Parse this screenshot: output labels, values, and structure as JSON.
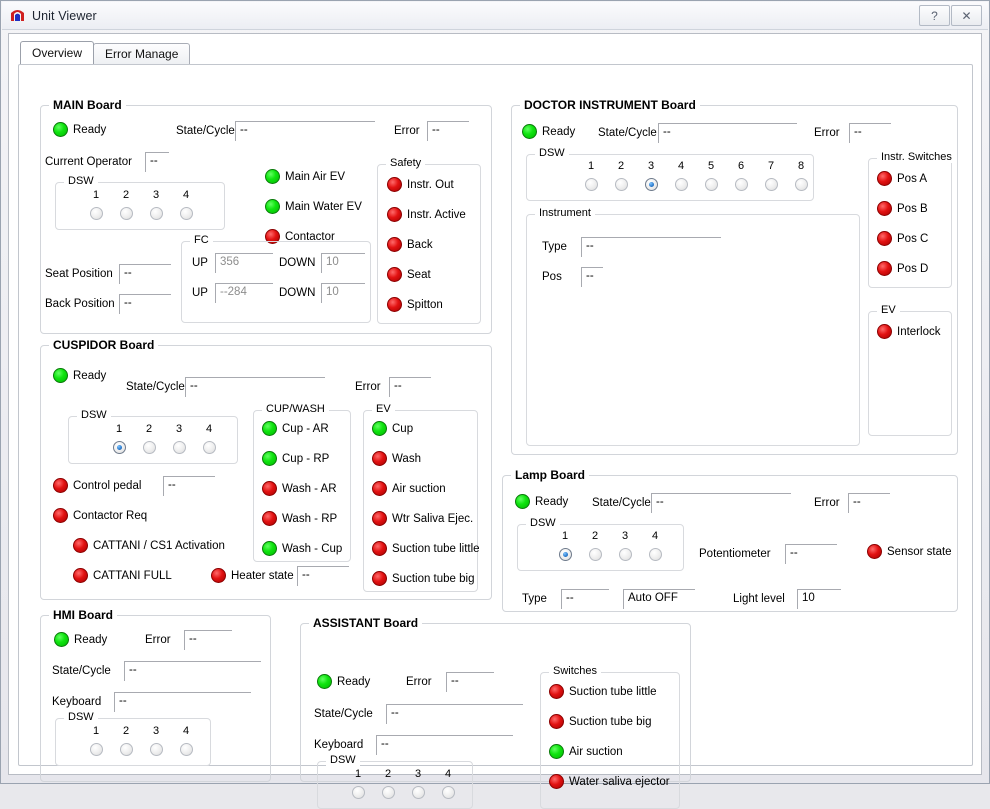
{
  "window": {
    "title": "Unit Viewer",
    "icon": "app-logo-icon",
    "help_label": "?",
    "close_label": "✕"
  },
  "tabs": [
    {
      "label": "Overview",
      "active": true
    },
    {
      "label": "Error Manage",
      "active": false
    }
  ],
  "common": {
    "ready": "Ready",
    "state_cycle": "State/Cycle",
    "error": "Error",
    "dsw": "DSW",
    "keyboard": "Keyboard",
    "type": "Type",
    "pos": "Pos",
    "dash": "--"
  },
  "main_board": {
    "title": "MAIN Board",
    "ready_label": "Ready",
    "ready_state": "green",
    "state_cycle_label": "State/Cycle",
    "state_cycle_value": "--",
    "error_label": "Error",
    "error_value": "--",
    "current_operator_label": "Current Operator",
    "current_operator_value": "--",
    "dsw_label": "DSW",
    "dsw_numbers": [
      "1",
      "2",
      "3",
      "4"
    ],
    "dsw_states": [
      false,
      false,
      false,
      false
    ],
    "seat_position_label": "Seat Position",
    "seat_position_value": "--",
    "back_position_label": "Back Position",
    "back_position_value": "--",
    "indicators": [
      {
        "label": "Main Air EV",
        "state": "green"
      },
      {
        "label": "Main Water EV",
        "state": "green"
      },
      {
        "label": "Contactor",
        "state": "red"
      }
    ],
    "fc": {
      "title": "FC",
      "rows": [
        {
          "up_label": "UP",
          "up_value": "356",
          "down_label": "DOWN",
          "down_value": "10"
        },
        {
          "up_label": "UP",
          "up_value": "--284",
          "down_label": "DOWN",
          "down_value": "10"
        }
      ]
    },
    "safety": {
      "title": "Safety",
      "items": [
        {
          "label": "Instr. Out",
          "state": "red"
        },
        {
          "label": "Instr. Active",
          "state": "red"
        },
        {
          "label": "Back",
          "state": "red"
        },
        {
          "label": "Seat",
          "state": "red"
        },
        {
          "label": "Spitton",
          "state": "red"
        }
      ]
    }
  },
  "doctor_board": {
    "title": "DOCTOR INSTRUMENT Board",
    "ready_label": "Ready",
    "ready_state": "green",
    "state_cycle_label": "State/Cycle",
    "state_cycle_value": "--",
    "error_label": "Error",
    "error_value": "--",
    "dsw_label": "DSW",
    "dsw_numbers": [
      "1",
      "2",
      "3",
      "4",
      "5",
      "6",
      "7",
      "8"
    ],
    "dsw_states": [
      false,
      false,
      true,
      false,
      false,
      false,
      false,
      false
    ],
    "instrument": {
      "title": "Instrument",
      "type_label": "Type",
      "type_value": "--",
      "pos_label": "Pos",
      "pos_value": "--"
    },
    "instr_switches": {
      "title": "Instr. Switches",
      "items": [
        {
          "label": "Pos A",
          "state": "red"
        },
        {
          "label": "Pos B",
          "state": "red"
        },
        {
          "label": "Pos C",
          "state": "red"
        },
        {
          "label": "Pos D",
          "state": "red"
        }
      ]
    },
    "ev": {
      "title": "EV",
      "items": [
        {
          "label": "Interlock",
          "state": "red"
        }
      ]
    }
  },
  "cuspidor_board": {
    "title": "CUSPIDOR Board",
    "ready_label": "Ready",
    "ready_state": "green",
    "state_cycle_label": "State/Cycle",
    "state_cycle_value": "--",
    "error_label": "Error",
    "error_value": "--",
    "dsw_label": "DSW",
    "dsw_numbers": [
      "1",
      "2",
      "3",
      "4"
    ],
    "dsw_states": [
      true,
      false,
      false,
      false
    ],
    "control_pedal_label": "Control pedal",
    "control_pedal_state": "red",
    "control_pedal_value": "--",
    "contactor_req_label": "Contactor Req",
    "contactor_req_state": "red",
    "cattani_activation_label": "CATTANI / CS1  Activation",
    "cattani_activation_state": "red",
    "cattani_full_label": "CATTANI FULL",
    "cattani_full_state": "red",
    "heater_state_label": "Heater state",
    "heater_state_state": "red",
    "heater_state_value": "--",
    "cup_wash": {
      "title": "CUP/WASH",
      "items": [
        {
          "label": "Cup - AR",
          "state": "green"
        },
        {
          "label": "Cup - RP",
          "state": "green"
        },
        {
          "label": "Wash - AR",
          "state": "red"
        },
        {
          "label": "Wash - RP",
          "state": "red"
        },
        {
          "label": "Wash - Cup",
          "state": "green"
        }
      ]
    },
    "ev": {
      "title": "EV",
      "items": [
        {
          "label": "Cup",
          "state": "green"
        },
        {
          "label": "Wash",
          "state": "red"
        },
        {
          "label": "Air suction",
          "state": "red"
        },
        {
          "label": "Wtr Saliva Ejec.",
          "state": "red"
        },
        {
          "label": "Suction tube little",
          "state": "red"
        },
        {
          "label": "Suction tube big",
          "state": "red"
        }
      ]
    }
  },
  "lamp_board": {
    "title": "Lamp Board",
    "ready_label": "Ready",
    "ready_state": "green",
    "state_cycle_label": "State/Cycle",
    "state_cycle_value": "--",
    "error_label": "Error",
    "error_value": "--",
    "dsw_label": "DSW",
    "dsw_numbers": [
      "1",
      "2",
      "3",
      "4"
    ],
    "dsw_states": [
      true,
      false,
      false,
      false
    ],
    "potentiometer_label": "Potentiometer",
    "potentiometer_value": "--",
    "sensor_state_label": "Sensor state",
    "sensor_state_state": "red",
    "type_label": "Type",
    "type_value": "--",
    "auto_value": "Auto OFF",
    "light_level_label": "Light level",
    "light_level_value": "10"
  },
  "hmi_board": {
    "title": "HMI Board",
    "ready_label": "Ready",
    "ready_state": "green",
    "error_label": "Error",
    "error_value": "--",
    "state_cycle_label": "State/Cycle",
    "state_cycle_value": "--",
    "keyboard_label": "Keyboard",
    "keyboard_value": "--",
    "dsw_label": "DSW",
    "dsw_numbers": [
      "1",
      "2",
      "3",
      "4"
    ],
    "dsw_states": [
      false,
      false,
      false,
      false
    ]
  },
  "assistant_board": {
    "title": "ASSISTANT Board",
    "ready_label": "Ready",
    "ready_state": "green",
    "error_label": "Error",
    "error_value": "--",
    "state_cycle_label": "State/Cycle",
    "state_cycle_value": "--",
    "keyboard_label": "Keyboard",
    "keyboard_value": "--",
    "dsw_label": "DSW",
    "dsw_numbers": [
      "1",
      "2",
      "3",
      "4"
    ],
    "dsw_states": [
      false,
      false,
      false,
      false
    ],
    "switches": {
      "title": "Switches",
      "items": [
        {
          "label": "Suction tube little",
          "state": "red"
        },
        {
          "label": "Suction tube big",
          "state": "red"
        },
        {
          "label": "Air suction",
          "state": "green"
        },
        {
          "label": "Water saliva ejector",
          "state": "red"
        }
      ]
    }
  },
  "colors": {
    "led_green": "#10e410",
    "led_red": "#e21212",
    "radio_on": "#1f6fc4",
    "group_border": "#d2d5da",
    "field_border": "#a8aab0"
  }
}
